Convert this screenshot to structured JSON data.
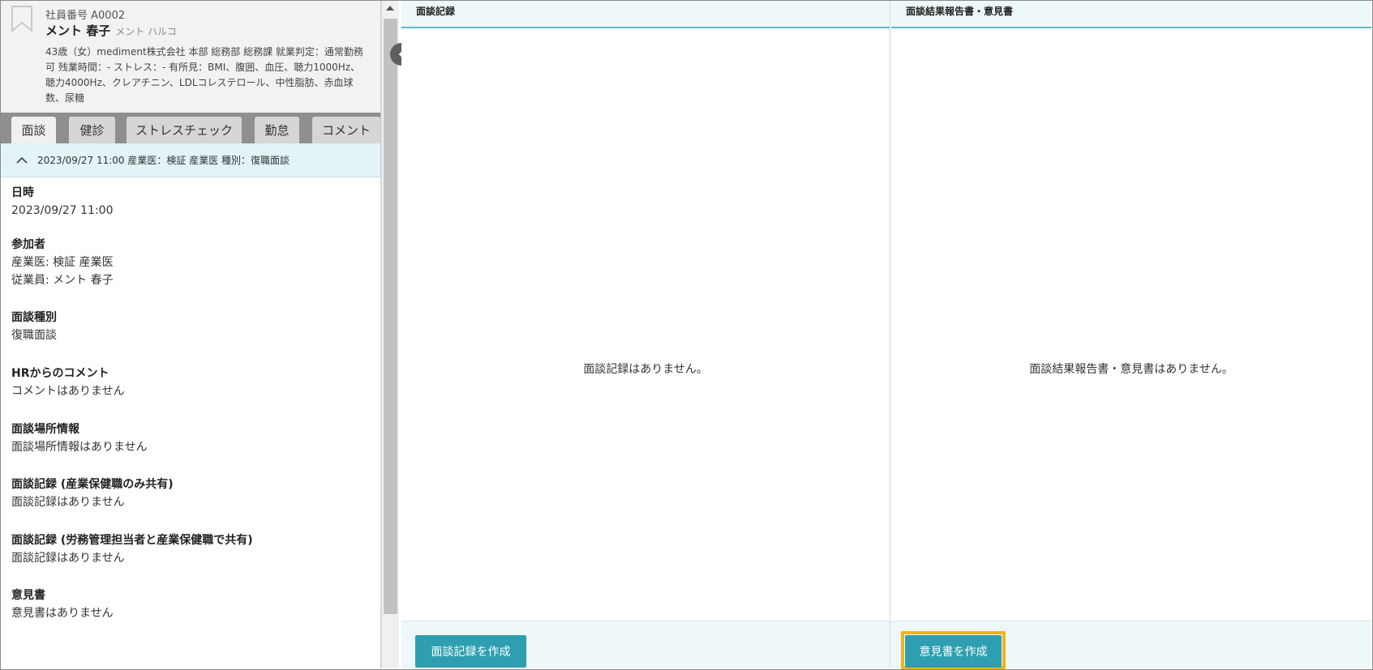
{
  "profile": {
    "employee_no": "社員番号 A0002",
    "name": "メント 春子",
    "name_kana": "メント ハルコ",
    "detail": "43歳（女）mediment株式会社 本部 総務部 総務課 就業判定：通常勤務可 残業時間：- ストレス：- 有所見：BMI、腹囲、血圧、聴力1000Hz、聴力4000Hz、クレアチニン、LDLコレステロール、中性脂肪、赤血球数、尿糖"
  },
  "tabs": [
    {
      "label": "面談",
      "active": true
    },
    {
      "label": "健診",
      "active": false
    },
    {
      "label": "ストレスチェック",
      "active": false
    },
    {
      "label": "勤怠",
      "active": false
    },
    {
      "label": "コメント",
      "active": false
    }
  ],
  "meeting_summary": "2023/09/27 11:00  産業医：検証 産業医  種別：復職面談",
  "details": [
    {
      "title": "日時",
      "values": [
        "2023/09/27 11:00"
      ]
    },
    {
      "title": "参加者",
      "values": [
        "産業医: 検証 産業医",
        "従業員: メント 春子"
      ]
    },
    {
      "title": "面談種別",
      "values": [
        "復職面談"
      ]
    },
    {
      "title": "HRからのコメント",
      "values": [
        "コメントはありません"
      ]
    },
    {
      "title": "面談場所情報",
      "values": [
        "面談場所情報はありません"
      ]
    },
    {
      "title": "面談記録 (産業保健職のみ共有)",
      "values": [
        "面談記録はありません"
      ]
    },
    {
      "title": "面談記録 (労務管理担当者と産業保健職で共有)",
      "values": [
        "面談記録はありません"
      ]
    },
    {
      "title": "意見書",
      "values": [
        "意見書はありません"
      ]
    }
  ],
  "record_column": {
    "header": "面談記録",
    "empty_text": "面談記録はありません。",
    "button_label": "面談記録を作成"
  },
  "report_column": {
    "header": "面談結果報告書・意見書",
    "empty_text": "面談結果報告書・意見書はありません。",
    "button_label": "意見書を作成"
  },
  "colors": {
    "accent": "#2e9fb0",
    "highlight": "#f5b21a"
  }
}
